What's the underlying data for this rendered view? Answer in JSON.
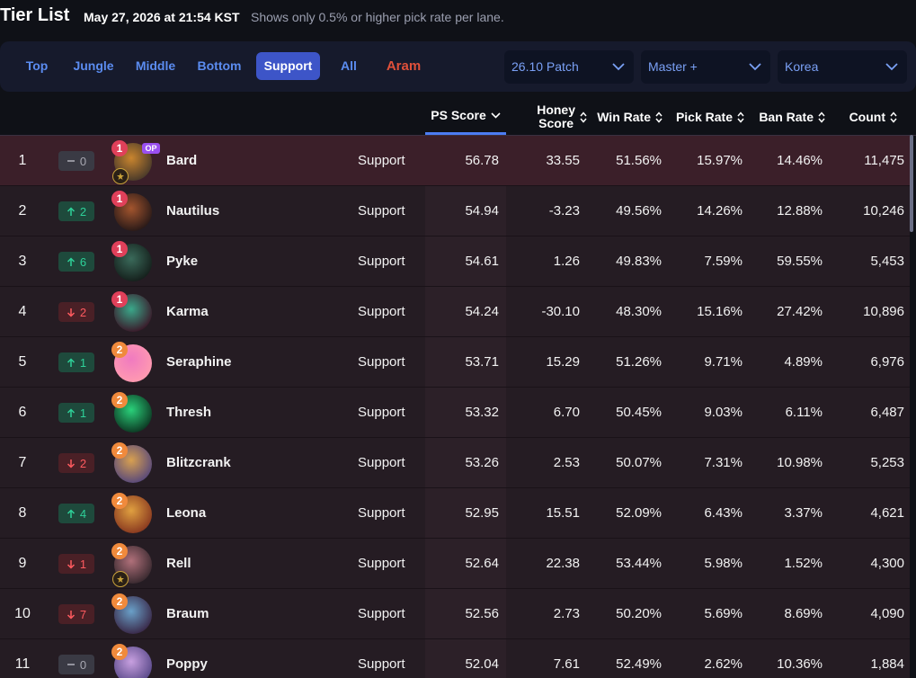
{
  "header": {
    "title": "Tier List",
    "date": "May 27, 2026 at 21:54 KST",
    "note": "Shows only 0.5% or higher pick rate per lane."
  },
  "lanes": [
    {
      "label": "Top"
    },
    {
      "label": "Jungle"
    },
    {
      "label": "Middle"
    },
    {
      "label": "Bottom"
    },
    {
      "label": "Support",
      "active": true
    },
    {
      "label": "All"
    },
    {
      "label": "Aram"
    }
  ],
  "filters": {
    "patch": "26.10 Patch",
    "tier": "Master +",
    "region": "Korea"
  },
  "columns": {
    "ps": "PS Score",
    "honey": "Honey Score",
    "honey_l1": "Honey",
    "honey_l2": "Score",
    "win": "Win Rate",
    "pick": "Pick Rate",
    "ban": "Ban Rate",
    "count": "Count"
  },
  "colors": {
    "accent": "#3d55c8",
    "up": "#2ed199",
    "down": "#ff5a5f",
    "tier1": "#e0405a",
    "tier2": "#f08a3c",
    "op": "#9a4ff0"
  },
  "rows": [
    {
      "rank": "1",
      "change": "0",
      "dir": "flat",
      "tier": "1",
      "op": "OP",
      "role_icon": "support-role-icon",
      "name": "Bard",
      "role": "Support",
      "ps": "56.78",
      "honey": "33.55",
      "win": "51.56%",
      "pick": "15.97%",
      "ban": "14.46%",
      "count": "11,475"
    },
    {
      "rank": "2",
      "change": "2",
      "dir": "up",
      "tier": "1",
      "name": "Nautilus",
      "role": "Support",
      "ps": "54.94",
      "honey": "-3.23",
      "win": "49.56%",
      "pick": "14.26%",
      "ban": "12.88%",
      "count": "10,246"
    },
    {
      "rank": "3",
      "change": "6",
      "dir": "up",
      "tier": "1",
      "name": "Pyke",
      "role": "Support",
      "ps": "54.61",
      "honey": "1.26",
      "win": "49.83%",
      "pick": "7.59%",
      "ban": "59.55%",
      "count": "5,453"
    },
    {
      "rank": "4",
      "change": "2",
      "dir": "down",
      "tier": "1",
      "name": "Karma",
      "role": "Support",
      "ps": "54.24",
      "honey": "-30.10",
      "win": "48.30%",
      "pick": "15.16%",
      "ban": "27.42%",
      "count": "10,896"
    },
    {
      "rank": "5",
      "change": "1",
      "dir": "up",
      "tier": "2",
      "name": "Seraphine",
      "role": "Support",
      "ps": "53.71",
      "honey": "15.29",
      "win": "51.26%",
      "pick": "9.71%",
      "ban": "4.89%",
      "count": "6,976"
    },
    {
      "rank": "6",
      "change": "1",
      "dir": "up",
      "tier": "2",
      "name": "Thresh",
      "role": "Support",
      "ps": "53.32",
      "honey": "6.70",
      "win": "50.45%",
      "pick": "9.03%",
      "ban": "6.11%",
      "count": "6,487"
    },
    {
      "rank": "7",
      "change": "2",
      "dir": "down",
      "tier": "2",
      "name": "Blitzcrank",
      "role": "Support",
      "ps": "53.26",
      "honey": "2.53",
      "win": "50.07%",
      "pick": "7.31%",
      "ban": "10.98%",
      "count": "5,253"
    },
    {
      "rank": "8",
      "change": "4",
      "dir": "up",
      "tier": "2",
      "name": "Leona",
      "role": "Support",
      "ps": "52.95",
      "honey": "15.51",
      "win": "52.09%",
      "pick": "6.43%",
      "ban": "3.37%",
      "count": "4,621"
    },
    {
      "rank": "9",
      "change": "1",
      "dir": "down",
      "tier": "2",
      "role_icon": "support-role-icon",
      "name": "Rell",
      "role": "Support",
      "ps": "52.64",
      "honey": "22.38",
      "win": "53.44%",
      "pick": "5.98%",
      "ban": "1.52%",
      "count": "4,300"
    },
    {
      "rank": "10",
      "change": "7",
      "dir": "down",
      "tier": "2",
      "name": "Braum",
      "role": "Support",
      "ps": "52.56",
      "honey": "2.73",
      "win": "50.20%",
      "pick": "5.69%",
      "ban": "8.69%",
      "count": "4,090"
    },
    {
      "rank": "11",
      "change": "0",
      "dir": "flat",
      "tier": "2",
      "name": "Poppy",
      "role": "Support",
      "ps": "52.04",
      "honey": "7.61",
      "win": "52.49%",
      "pick": "2.62%",
      "ban": "10.36%",
      "count": "1,884"
    }
  ]
}
